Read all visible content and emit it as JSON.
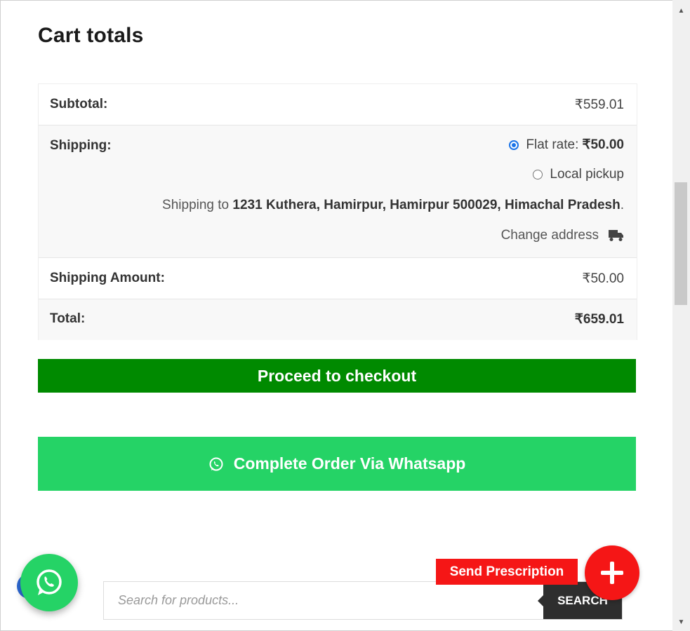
{
  "cart": {
    "title": "Cart totals",
    "subtotal_label": "Subtotal:",
    "subtotal_value": "₹559.01",
    "shipping_label": "Shipping:",
    "flat_rate_label": "Flat rate: ",
    "flat_rate_value": "₹50.00",
    "local_pickup_label": "Local pickup",
    "shipping_to_prefix": "Shipping to ",
    "shipping_to_address": "1231 Kuthera, Hamirpur, Hamirpur 500029, Himachal Pradesh",
    "shipping_to_suffix": ".",
    "change_address_label": "Change address",
    "shipping_amount_label": "Shipping Amount:",
    "shipping_amount_value": "₹50.00",
    "total_label": "Total:",
    "total_value": "₹659.01"
  },
  "buttons": {
    "checkout": "Proceed to checkout",
    "whatsapp_order": "Complete Order Via Whatsapp",
    "send_prescription": "Send Prescription"
  },
  "search": {
    "placeholder": "Search for products...",
    "button_label": "SEARCH"
  },
  "icons": {
    "truck": "truck-icon",
    "whatsapp": "whatsapp-icon",
    "plus": "plus-icon"
  },
  "colors": {
    "checkout_green": "#008a00",
    "whatsapp_green": "#25d366",
    "prescription_red": "#f51616",
    "search_button": "#2e2e2e"
  }
}
